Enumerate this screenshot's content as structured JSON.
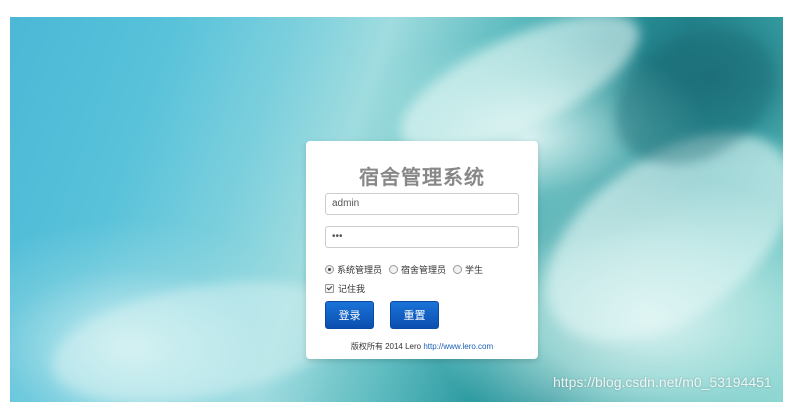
{
  "login": {
    "title": "宿舍管理系统",
    "username_value": "admin",
    "password_value": "•••",
    "roles": [
      {
        "label": "系统管理员",
        "checked": true
      },
      {
        "label": "宿舍管理员",
        "checked": false
      },
      {
        "label": "学生",
        "checked": false
      }
    ],
    "remember_label": "记住我",
    "remember_checked": true,
    "login_button": "登录",
    "reset_button": "重置",
    "copyright_text": "版权所有 2014 Lero",
    "copyright_link": "http://www.lero.com"
  },
  "watermark": "https://blog.csdn.net/m0_53194451",
  "colors": {
    "button": "#0b5fc4",
    "link": "#1a5fb4"
  }
}
